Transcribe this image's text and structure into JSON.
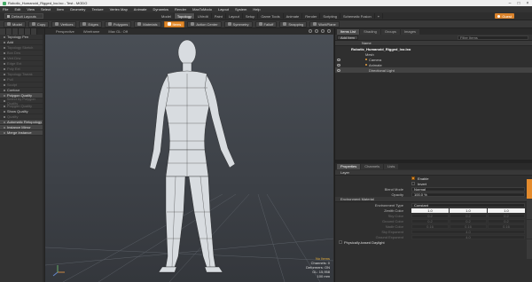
{
  "window": {
    "title": "Robotic_Humanoid_Rigged_lxo.lxo - Test - MODO"
  },
  "menu": [
    "File",
    "Edit",
    "View",
    "Select",
    "Item",
    "Geometry",
    "Texture",
    "Vertex Map",
    "Animate",
    "Dynamics",
    "Render",
    "MaxToModo",
    "Layout",
    "System",
    "Help"
  ],
  "layout": {
    "selector": "Default Layouts",
    "tabs": [
      "Model",
      "Topology",
      "UVedit",
      "Paint",
      "Layout",
      "Setup",
      "Game Tools",
      "Animate",
      "Render",
      "Scripting",
      "Schematic Fusion"
    ],
    "active_tab": "Topology",
    "user": "Guest"
  },
  "toolbar": {
    "items": [
      {
        "label": "Model",
        "on": false
      },
      {
        "label": "Copy",
        "on": false
      },
      {
        "label": "Vertices",
        "on": false
      },
      {
        "label": "Edges",
        "on": false
      },
      {
        "label": "Polygons",
        "on": false
      },
      {
        "label": "Materials",
        "on": false
      },
      {
        "label": "Items",
        "on": true
      },
      {
        "label": "Action Center",
        "on": false
      },
      {
        "label": "Symmetry",
        "on": false
      },
      {
        "label": "Falloff",
        "on": false
      },
      {
        "label": "Snapping",
        "on": false
      },
      {
        "label": "WorkPlane",
        "on": false
      }
    ]
  },
  "left_panel": {
    "items": [
      {
        "label": "Topology Pen",
        "dim": false,
        "hdr": false
      },
      {
        "label": "Add",
        "dim": false,
        "hdr": false
      },
      {
        "label": "Topology Sketch",
        "dim": true,
        "hdr": false
      },
      {
        "label": "Box Drw",
        "dim": true,
        "hdr": false
      },
      {
        "label": "Vert Drw",
        "dim": true,
        "hdr": false
      },
      {
        "label": "Edge Ext",
        "dim": true,
        "hdr": false
      },
      {
        "label": "Poly Ext",
        "dim": true,
        "hdr": false
      },
      {
        "label": "Topology Tweak",
        "dim": true,
        "hdr": false
      },
      {
        "label": "Pull",
        "dim": true,
        "hdr": false
      },
      {
        "label": "Sculpt",
        "dim": true,
        "hdr": false
      },
      {
        "label": "Contour",
        "dim": false,
        "hdr": false
      },
      {
        "label": "Polygon Quality",
        "dim": false,
        "hdr": true
      },
      {
        "label": "Select by Polygon Quality",
        "dim": true,
        "hdr": false
      },
      {
        "label": "Polygon Quality",
        "dim": true,
        "hdr": false
      },
      {
        "label": "Show Quality",
        "dim": false,
        "hdr": false
      },
      {
        "label": "Quality",
        "dim": true,
        "hdr": false
      },
      {
        "label": "Automatic Retopology",
        "dim": false,
        "hdr": true
      },
      {
        "label": "Instance Mirror",
        "dim": false,
        "hdr": true
      },
      {
        "label": "Merge Instance",
        "dim": false,
        "hdr": true
      }
    ]
  },
  "viewport": {
    "tabs": [
      "Perspective",
      "Wireframe",
      "Max GL: Off"
    ],
    "info": {
      "warn": "No Items",
      "lines": [
        "Channels: 0",
        "Deformers: ON",
        "GL: 15,958",
        "100 mm"
      ]
    }
  },
  "items_panel": {
    "tabs": [
      "Items List",
      "Shading",
      "Groups",
      "Images"
    ],
    "active_tab": "Items List",
    "buttons": [
      "Add Item"
    ],
    "filter_placeholder": "Filter Items",
    "column_header": "Name",
    "tree": [
      {
        "label": "Robotic_Humanoid_Rigged_lxo.lxo",
        "indent": 18,
        "sel": false,
        "eye": false,
        "bullet": false,
        "bold": true
      },
      {
        "label": "Mesh",
        "indent": 34,
        "sel": false,
        "eye": false,
        "bullet": false,
        "bold": false
      },
      {
        "label": "Camera",
        "indent": 34,
        "sel": false,
        "eye": true,
        "bullet": true,
        "bold": false
      },
      {
        "label": "Animate",
        "indent": 34,
        "sel": false,
        "eye": true,
        "bullet": true,
        "bold": false
      },
      {
        "label": "Directional Light",
        "indent": 38,
        "sel": true,
        "eye": true,
        "bullet": false,
        "bold": false
      }
    ]
  },
  "properties": {
    "tabs": [
      "Properties",
      "Channels",
      "Lists"
    ],
    "active_tab": "Properties",
    "layer_header": "Layer",
    "enable_label": "Enable",
    "invert_label": "Invert",
    "blend_mode_label": "Blend Mode",
    "blend_mode_value": "Normal",
    "opacity_label": "Opacity",
    "opacity_value": "100.0 %",
    "env_header": "Environment Material",
    "env_type_label": "Environment Type",
    "env_type_value": "Constant",
    "zenith_label": "Zenith Color",
    "zenith_values": [
      "1.0",
      "1.0",
      "1.0"
    ],
    "dim_rows": [
      {
        "label": "Sky Color",
        "values": [
          "0.2",
          "0.2",
          "0.2"
        ]
      },
      {
        "label": "Ground Color",
        "values": [
          "0.2",
          "0.2",
          "0.2"
        ]
      },
      {
        "label": "Nadir Color",
        "values": [
          "0.16",
          "0.16",
          "0.16"
        ]
      },
      {
        "label": "Sky Exponent",
        "values": [
          "4.0"
        ]
      },
      {
        "label": "Ground Exponent",
        "values": [
          "4.0"
        ]
      }
    ],
    "physical_sky_label": "Physically-based Daylight"
  },
  "colors": {
    "accent": "#e38a2c",
    "viewport_top": "#4a4f56",
    "panel": "#2f2f2f"
  }
}
